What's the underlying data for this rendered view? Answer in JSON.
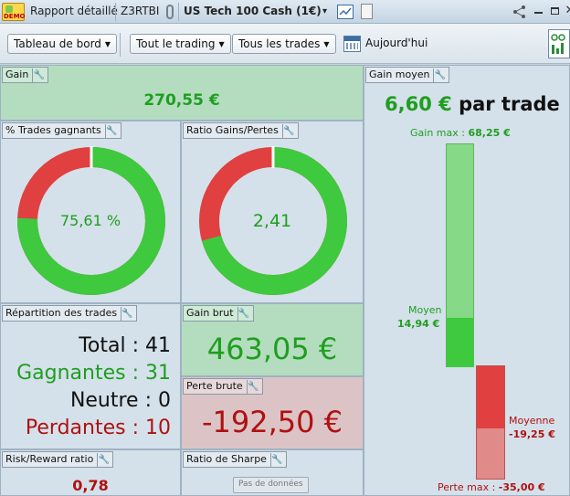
{
  "titlebar": {
    "demo_badge": "DEMO",
    "tab_report": "Rapport détaillé",
    "account": "Z3RTBI",
    "instrument": "US Tech 100 Cash (1€)",
    "dropdown_arrow": "▾",
    "icons": [
      "demo-badge",
      "link-icon",
      "chart-icon",
      "document-icon",
      "share-icon",
      "minimize-icon",
      "maximize-icon",
      "close-icon"
    ]
  },
  "toolbar": {
    "dashboard": "Tableau de bord",
    "trading": "Tout le trading",
    "trades": "Tous les trades",
    "date": "Aujourd'hui"
  },
  "panels": {
    "gain": {
      "title": "Gain",
      "value": "270,55 €"
    },
    "win_trades": {
      "title": "% Trades gagnants",
      "value": "75,61 %",
      "fraction": 0.7561
    },
    "ratio": {
      "title": "Ratio Gains/Pertes",
      "value": "2,41",
      "fraction": 0.7067
    },
    "repartition": {
      "title": "Répartition des trades",
      "total_label": "Total : 41",
      "wins_label": "Gagnantes : 31",
      "neutral_label": "Neutre : 0",
      "losses_label": "Perdantes : 10"
    },
    "gross_gain": {
      "title": "Gain brut",
      "value": "463,05 €"
    },
    "gross_loss": {
      "title": "Perte brute",
      "value": "-192,50 €"
    },
    "risk_reward": {
      "title": "Risk/Reward ratio",
      "value": "0,78"
    },
    "sharpe": {
      "title": "Ratio de Sharpe",
      "no_data": "Pas de données"
    },
    "avg_gain": {
      "title": "Gain moyen",
      "value": "6,60 €",
      "suffix": "par trade",
      "max_gain_label": "Gain max :",
      "max_gain_value": "68,25 €",
      "avg_label": "Moyen",
      "avg_value": "14,94 €",
      "avg_loss_label": "Moyenne",
      "avg_loss_value": "-19,25 €",
      "max_loss_label": "Perte max :",
      "max_loss_value": "-35,00 €"
    }
  },
  "colors": {
    "win": "#3ec93e",
    "loss": "#e04040",
    "win_light": "#86d986",
    "loss_light": "#e08a8a"
  }
}
